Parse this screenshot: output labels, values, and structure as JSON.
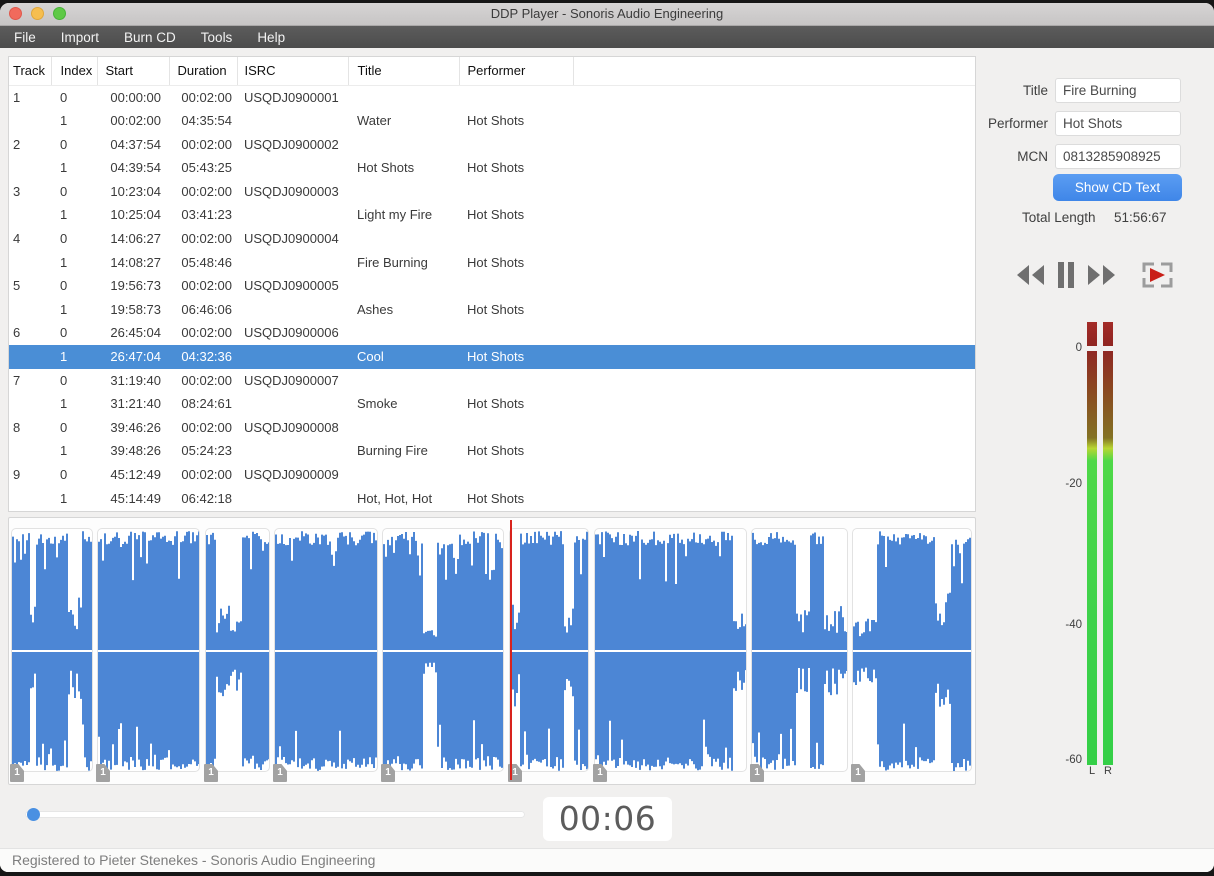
{
  "window": {
    "title": "DDP Player - Sonoris Audio Engineering"
  },
  "menu": {
    "items": [
      "File",
      "Import",
      "Burn CD",
      "Tools",
      "Help"
    ]
  },
  "track_table": {
    "columns": [
      "Track",
      "Index",
      "Start",
      "Duration",
      "ISRC",
      "Title",
      "Performer"
    ],
    "selected_row": 11,
    "rows": [
      {
        "track": "1",
        "index": "0",
        "start": "00:00:00",
        "duration": "00:02:00",
        "isrc": "USQDJ0900001",
        "title": "",
        "performer": ""
      },
      {
        "track": "",
        "index": "1",
        "start": "00:02:00",
        "duration": "04:35:54",
        "isrc": "",
        "title": "Water",
        "performer": "Hot Shots"
      },
      {
        "track": "2",
        "index": "0",
        "start": "04:37:54",
        "duration": "00:02:00",
        "isrc": "USQDJ0900002",
        "title": "",
        "performer": ""
      },
      {
        "track": "",
        "index": "1",
        "start": "04:39:54",
        "duration": "05:43:25",
        "isrc": "",
        "title": "Hot Shots",
        "performer": "Hot Shots"
      },
      {
        "track": "3",
        "index": "0",
        "start": "10:23:04",
        "duration": "00:02:00",
        "isrc": "USQDJ0900003",
        "title": "",
        "performer": ""
      },
      {
        "track": "",
        "index": "1",
        "start": "10:25:04",
        "duration": "03:41:23",
        "isrc": "",
        "title": "Light my Fire",
        "performer": "Hot Shots"
      },
      {
        "track": "4",
        "index": "0",
        "start": "14:06:27",
        "duration": "00:02:00",
        "isrc": "USQDJ0900004",
        "title": "",
        "performer": ""
      },
      {
        "track": "",
        "index": "1",
        "start": "14:08:27",
        "duration": "05:48:46",
        "isrc": "",
        "title": "Fire Burning",
        "performer": "Hot Shots"
      },
      {
        "track": "5",
        "index": "0",
        "start": "19:56:73",
        "duration": "00:02:00",
        "isrc": "USQDJ0900005",
        "title": "",
        "performer": ""
      },
      {
        "track": "",
        "index": "1",
        "start": "19:58:73",
        "duration": "06:46:06",
        "isrc": "",
        "title": "Ashes",
        "performer": "Hot Shots"
      },
      {
        "track": "6",
        "index": "0",
        "start": "26:45:04",
        "duration": "00:02:00",
        "isrc": "USQDJ0900006",
        "title": "",
        "performer": ""
      },
      {
        "track": "",
        "index": "1",
        "start": "26:47:04",
        "duration": "04:32:36",
        "isrc": "",
        "title": "Cool",
        "performer": "Hot Shots"
      },
      {
        "track": "7",
        "index": "0",
        "start": "31:19:40",
        "duration": "00:02:00",
        "isrc": "USQDJ0900007",
        "title": "",
        "performer": ""
      },
      {
        "track": "",
        "index": "1",
        "start": "31:21:40",
        "duration": "08:24:61",
        "isrc": "",
        "title": "Smoke",
        "performer": "Hot Shots"
      },
      {
        "track": "8",
        "index": "0",
        "start": "39:46:26",
        "duration": "00:02:00",
        "isrc": "USQDJ0900008",
        "title": "",
        "performer": ""
      },
      {
        "track": "",
        "index": "1",
        "start": "39:48:26",
        "duration": "05:24:23",
        "isrc": "",
        "title": "Burning Fire",
        "performer": "Hot Shots"
      },
      {
        "track": "9",
        "index": "0",
        "start": "45:12:49",
        "duration": "00:02:00",
        "isrc": "USQDJ0900009",
        "title": "",
        "performer": ""
      },
      {
        "track": "",
        "index": "1",
        "start": "45:14:49",
        "duration": "06:42:18",
        "isrc": "",
        "title": "Hot, Hot, Hot",
        "performer": "Hot Shots"
      }
    ]
  },
  "cd_text": {
    "title_label": "Title",
    "title_value": "Fire Burning",
    "performer_label": "Performer",
    "performer_value": "Hot Shots",
    "mcn_label": "MCN",
    "mcn_value": "0813285908925",
    "show_button_label": "Show CD Text",
    "total_length_label": "Total Length",
    "total_length_value": "51:56:67"
  },
  "transport": {
    "icons": [
      "rewind-icon",
      "pause-icon",
      "fast-forward-icon",
      "play-selection-icon"
    ]
  },
  "meters": {
    "scale_labels": [
      "0",
      "-20",
      "-40",
      "-60"
    ],
    "channel_labels": [
      "L",
      "R"
    ]
  },
  "playback": {
    "elapsed_time": "00:06",
    "slider_position_frac": 0.016
  },
  "waveform": {
    "playhead_frac": 0.5176,
    "segments": [
      {
        "label": "1",
        "start": 0.0,
        "end": 0.0895
      },
      {
        "label": "1",
        "start": 0.0895,
        "end": 0.2006
      },
      {
        "label": "1",
        "start": 0.2006,
        "end": 0.2721
      },
      {
        "label": "1",
        "start": 0.2721,
        "end": 0.3845
      },
      {
        "label": "1",
        "start": 0.3845,
        "end": 0.5157
      },
      {
        "label": "1",
        "start": 0.5157,
        "end": 0.6036
      },
      {
        "label": "1",
        "start": 0.6036,
        "end": 0.7664
      },
      {
        "label": "1",
        "start": 0.7664,
        "end": 0.871
      },
      {
        "label": "1",
        "start": 0.871,
        "end": 1.0
      }
    ]
  },
  "status_bar": {
    "registered_text": "Registered to Pieter Stenekes - Sonoris Audio Engineering"
  },
  "colors": {
    "accent_blue": "#4a90e2",
    "selection_blue": "#4a8ed6",
    "waveform_blue": "#4c86d5",
    "playhead_red": "#d8231d",
    "meter_green": "#3ed24b",
    "meter_clip_red": "#9d2b27"
  }
}
